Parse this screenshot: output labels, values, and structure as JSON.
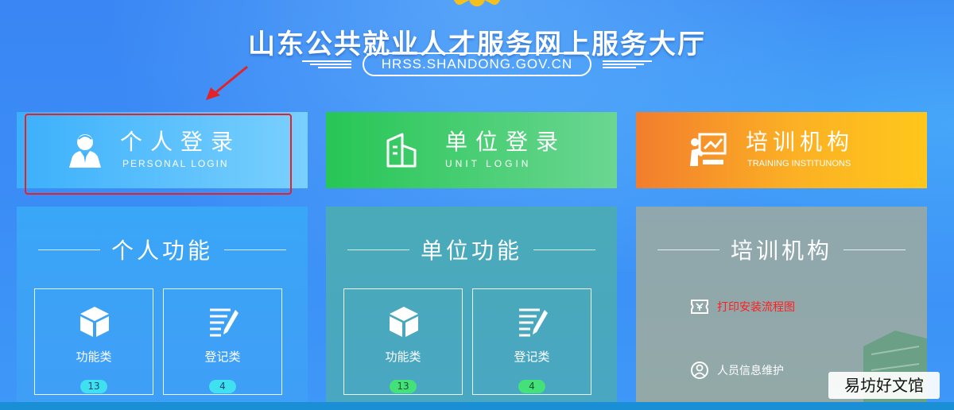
{
  "header": {
    "title": "山东公共就业人才服务网上服务大厅",
    "url": "HRSS.SHANDONG.GOV.CN",
    "logo_icon": "emblem-logo-icon"
  },
  "login_cards": [
    {
      "title": "个人登录",
      "subtitle": "PERSONAL LOGIN",
      "icon": "person-icon",
      "color": "#3cb0fb"
    },
    {
      "title": "单位登录",
      "subtitle": "UNIT LOGIN",
      "icon": "building-icon",
      "color": "#27c655"
    },
    {
      "title": "培训机构",
      "subtitle": "TRAINING INSTITUNONS",
      "icon": "training-board-icon",
      "color": "#f8a126"
    }
  ],
  "panels": {
    "personal": {
      "title": "个人功能",
      "items": [
        {
          "label": "功能类",
          "count": "13",
          "icon": "cube-icon"
        },
        {
          "label": "登记类",
          "count": "4",
          "icon": "edit-list-icon"
        }
      ]
    },
    "unit": {
      "title": "单位功能",
      "items": [
        {
          "label": "功能类",
          "count": "13",
          "icon": "cube-icon"
        },
        {
          "label": "登记类",
          "count": "4",
          "icon": "edit-list-icon"
        }
      ]
    },
    "training": {
      "title": "培训机构",
      "items": [
        {
          "label": "打印安装流程图",
          "icon": "ticket-icon",
          "color": "#ff1d1d"
        },
        {
          "label": "人员信息维护",
          "icon": "person-circle-icon"
        }
      ]
    }
  },
  "annotation": {
    "highlight_color": "#e2232a",
    "arrow_color": "#e2232a"
  },
  "watermark": {
    "text": "易坊好文馆"
  }
}
